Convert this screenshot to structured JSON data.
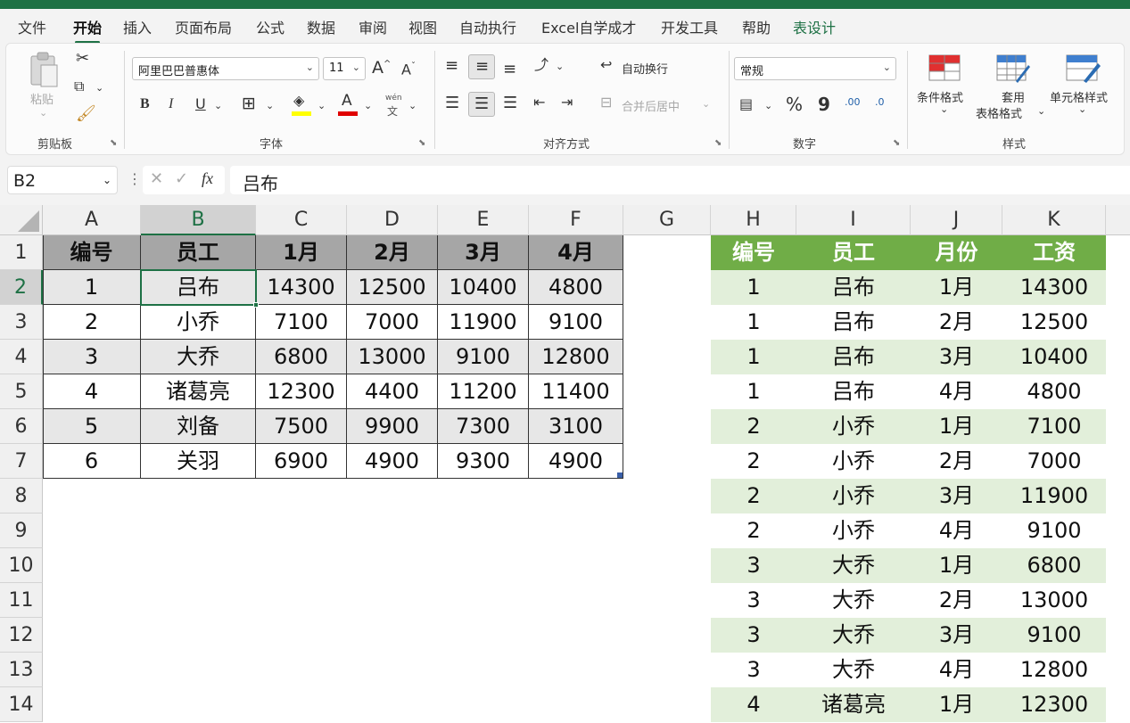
{
  "tabs": [
    "文件",
    "开始",
    "插入",
    "页面布局",
    "公式",
    "数据",
    "审阅",
    "视图",
    "自动执行",
    "Excel自学成才",
    "开发工具",
    "帮助",
    "表设计"
  ],
  "clipboard": {
    "paste_label": "粘贴",
    "group_label": "剪贴板"
  },
  "font": {
    "name": "阿里巴巴普惠体",
    "size": "11",
    "group_label": "字体",
    "grow_label": "A",
    "shrink_label": "A",
    "bold": "B",
    "italic": "I",
    "underline": "U",
    "font_color_label": "A",
    "phonetic_top": "wén",
    "phonetic_bottom": "文"
  },
  "alignment": {
    "wrap_label": "自动换行",
    "merge_label": "合并后居中",
    "group_label": "对齐方式"
  },
  "number": {
    "format": "常规",
    "percent": "%",
    "comma": "9",
    "group_label": "数字",
    "inc_decimal": ".00",
    "dec_decimal": ".0"
  },
  "styles": {
    "conditional": "条件格式",
    "table_top": "套用",
    "table_bottom": "表格格式",
    "cell_styles": "单元格样式",
    "group_label": "样式"
  },
  "formula_bar": {
    "name_box": "B2",
    "fx": "fx",
    "content": "吕布"
  },
  "columns": [
    "A",
    "B",
    "C",
    "D",
    "E",
    "F",
    "G",
    "H",
    "I",
    "J",
    "K"
  ],
  "rows": [
    "1",
    "2",
    "3",
    "4",
    "5",
    "6",
    "7",
    "8",
    "9",
    "10",
    "11",
    "12",
    "13",
    "14"
  ],
  "left_table": {
    "header": [
      "编号",
      "员工",
      "1月",
      "2月",
      "3月",
      "4月"
    ],
    "rows": [
      [
        "1",
        "吕布",
        "14300",
        "12500",
        "10400",
        "4800"
      ],
      [
        "2",
        "小乔",
        "7100",
        "7000",
        "11900",
        "9100"
      ],
      [
        "3",
        "大乔",
        "6800",
        "13000",
        "9100",
        "12800"
      ],
      [
        "4",
        "诸葛亮",
        "12300",
        "4400",
        "11200",
        "11400"
      ],
      [
        "5",
        "刘备",
        "7500",
        "9900",
        "7300",
        "3100"
      ],
      [
        "6",
        "关羽",
        "6900",
        "4900",
        "9300",
        "4900"
      ]
    ]
  },
  "right_table": {
    "header": [
      "编号",
      "员工",
      "月份",
      "工资"
    ],
    "rows": [
      [
        "1",
        "吕布",
        "1月",
        "14300"
      ],
      [
        "1",
        "吕布",
        "2月",
        "12500"
      ],
      [
        "1",
        "吕布",
        "3月",
        "10400"
      ],
      [
        "1",
        "吕布",
        "4月",
        "4800"
      ],
      [
        "2",
        "小乔",
        "1月",
        "7100"
      ],
      [
        "2",
        "小乔",
        "2月",
        "7000"
      ],
      [
        "2",
        "小乔",
        "3月",
        "11900"
      ],
      [
        "2",
        "小乔",
        "4月",
        "9100"
      ],
      [
        "3",
        "大乔",
        "1月",
        "6800"
      ],
      [
        "3",
        "大乔",
        "2月",
        "13000"
      ],
      [
        "3",
        "大乔",
        "3月",
        "9100"
      ],
      [
        "3",
        "大乔",
        "4月",
        "12800"
      ],
      [
        "4",
        "诸葛亮",
        "1月",
        "12300"
      ]
    ]
  },
  "colors": {
    "accent": "#1e7145",
    "green_header": "#70ad47",
    "green_band": "#e2efda",
    "gray_header": "#a6a6a6"
  }
}
